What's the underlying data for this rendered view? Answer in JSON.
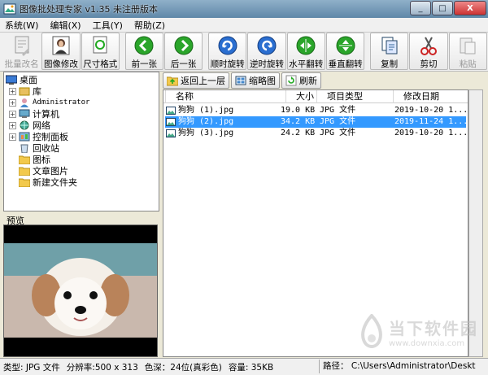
{
  "window": {
    "title": "图像批处理专家 v1.35 未注册版本",
    "controls": [
      "_",
      "□",
      "X"
    ]
  },
  "menu": [
    "系统(W)",
    "编辑(X)",
    "工具(Y)",
    "帮助(Z)"
  ],
  "toolbar": [
    {
      "label": "批量改名",
      "icon": "rename-icon",
      "state": "disabled"
    },
    {
      "label": "图像修改",
      "icon": "portrait-icon",
      "state": "raised"
    },
    {
      "label": "尺寸格式",
      "icon": "resize-icon",
      "state": "raised"
    },
    {
      "label": "前一张",
      "icon": "prev-arrow-icon",
      "state": "raised"
    },
    {
      "label": "后一张",
      "icon": "next-arrow-icon",
      "state": "raised"
    },
    {
      "label": "顺时旋转",
      "icon": "rotate-cw-icon",
      "state": "raised"
    },
    {
      "label": "逆时旋转",
      "icon": "rotate-ccw-icon",
      "state": "raised"
    },
    {
      "label": "水平翻转",
      "icon": "flip-horizontal-icon",
      "state": "raised"
    },
    {
      "label": "垂直翻转",
      "icon": "flip-vertical-icon",
      "state": "raised"
    },
    {
      "label": "复制",
      "icon": "copy-icon",
      "state": "raised"
    },
    {
      "label": "剪切",
      "icon": "scissors-icon",
      "state": "raised"
    },
    {
      "label": "粘贴",
      "icon": "paste-icon",
      "state": "disabled"
    }
  ],
  "tree": [
    {
      "label": "桌面",
      "icon": "desktop-icon",
      "level": 0,
      "expander": ""
    },
    {
      "label": "库",
      "icon": "library-icon",
      "level": 1,
      "expander": "+"
    },
    {
      "label": "Administrator",
      "icon": "user-icon",
      "level": 1,
      "expander": "+"
    },
    {
      "label": "计算机",
      "icon": "computer-icon",
      "level": 1,
      "expander": "+"
    },
    {
      "label": "网络",
      "icon": "network-icon",
      "level": 1,
      "expander": "+"
    },
    {
      "label": "控制面板",
      "icon": "control-panel-icon",
      "level": 1,
      "expander": "+"
    },
    {
      "label": "回收站",
      "icon": "recycle-bin-icon",
      "level": 1,
      "expander": ""
    },
    {
      "label": "图标",
      "icon": "folder-icon",
      "level": 1,
      "expander": ""
    },
    {
      "label": "文章图片",
      "icon": "folder-icon",
      "level": 1,
      "expander": ""
    },
    {
      "label": "新建文件夹",
      "icon": "folder-icon",
      "level": 1,
      "expander": ""
    }
  ],
  "preview": {
    "label": "预览"
  },
  "file_toolbar": {
    "up": "返回上一层",
    "thumbs": "缩略图",
    "refresh": "刷新"
  },
  "columns": [
    "名称",
    "大小",
    "项目类型",
    "修改日期"
  ],
  "files": [
    {
      "name": "狗狗 (1).jpg",
      "size": "19.0 KB",
      "type": "JPG 文件",
      "date": "2019-10-20 1...",
      "selected": false
    },
    {
      "name": "狗狗 (2).jpg",
      "size": "34.2 KB",
      "type": "JPG 文件",
      "date": "2019-11-24 1...",
      "selected": true
    },
    {
      "name": "狗狗 (3).jpg",
      "size": "24.2 KB",
      "type": "JPG 文件",
      "date": "2019-10-20 1...",
      "selected": false
    }
  ],
  "status": {
    "type": "类型: JPG 文件",
    "resolution": "分辨率:500 x 313",
    "depth": "色深：24位(真彩色)",
    "capacity": "容量: 35KB",
    "path": "路径： C:\\Users\\Administrator\\Deskt"
  },
  "watermark": {
    "name": "当下软件园",
    "url": "www.downxia.com"
  },
  "colors": {
    "selection": "#3399ff",
    "titlebar": "#6f95b5",
    "green_btn": "#2aa52a",
    "blue_btn": "#2a6ed0"
  }
}
